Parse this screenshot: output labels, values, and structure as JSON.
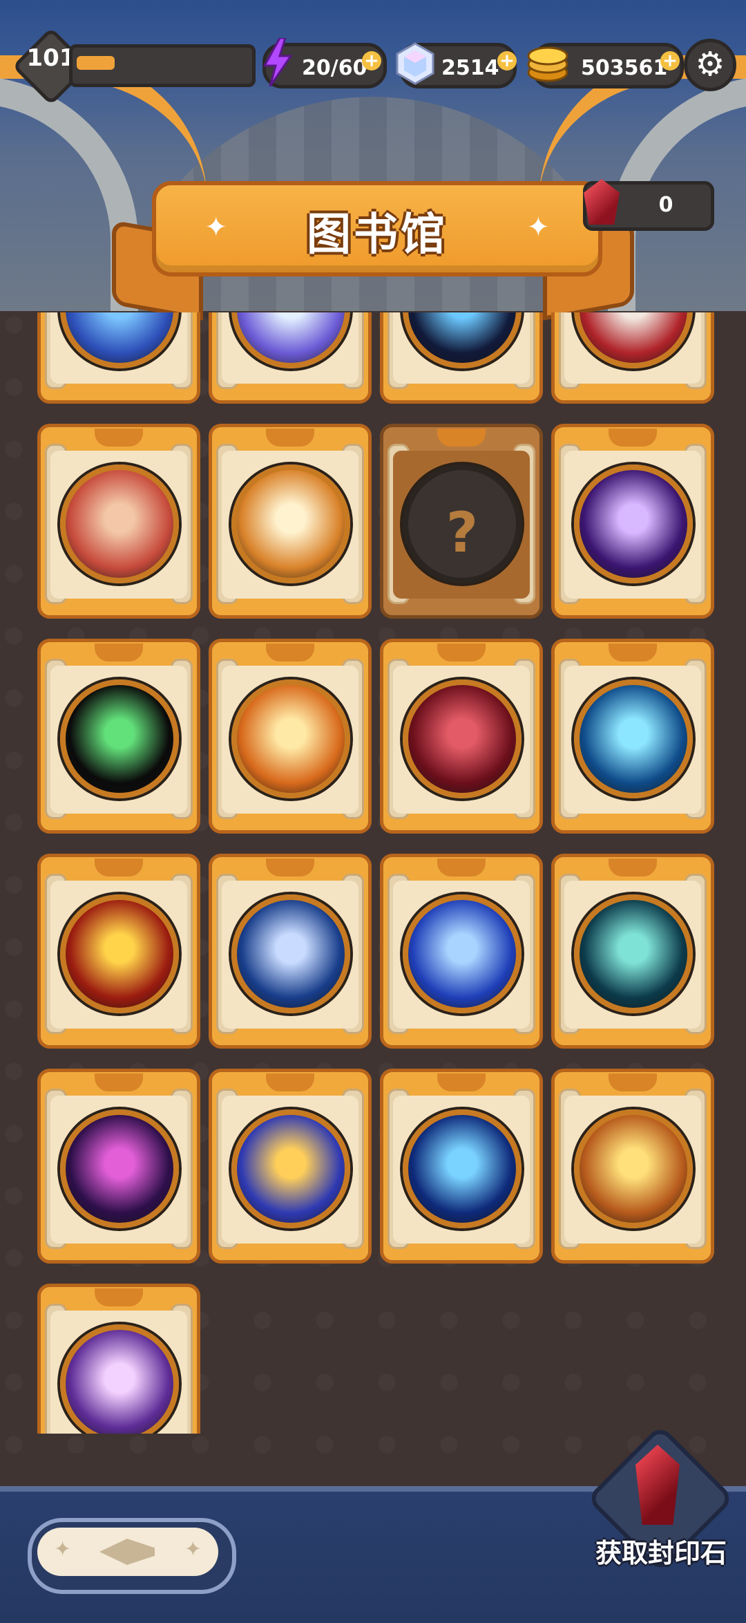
{
  "hud": {
    "level": "101",
    "xp_progress": 0.22,
    "energy": "20/60",
    "gems": "2514",
    "gold": "503561",
    "icons": {
      "energy": "lightning-icon",
      "gems": "diamond-icon",
      "gold": "coin-stack-icon",
      "settings": "gear-icon"
    }
  },
  "title": {
    "text": "图书馆"
  },
  "seal_counter": {
    "value": "0"
  },
  "cards": [
    {
      "id": "skill-1",
      "locked": false,
      "colors": [
        "#2d4fb8",
        "#7cc6ff"
      ]
    },
    {
      "id": "skill-2",
      "locked": false,
      "colors": [
        "#6c5bd6",
        "#e3f1ff"
      ]
    },
    {
      "id": "skill-3",
      "locked": false,
      "colors": [
        "#111a3a",
        "#6cc9ff"
      ]
    },
    {
      "id": "skill-4",
      "locked": false,
      "colors": [
        "#b0242a",
        "#f2e8e0"
      ]
    },
    {
      "id": "skill-5",
      "locked": false,
      "colors": [
        "#c74b3c",
        "#f3c7a8"
      ]
    },
    {
      "id": "skill-6",
      "locked": false,
      "colors": [
        "#d9822a",
        "#fff2cf"
      ]
    },
    {
      "id": "skill-7",
      "locked": true,
      "colors": [
        "#3a3330",
        "#3a3330"
      ]
    },
    {
      "id": "skill-8",
      "locked": false,
      "colors": [
        "#3b1570",
        "#d8b8ff"
      ]
    },
    {
      "id": "skill-9",
      "locked": false,
      "colors": [
        "#0b0b0b",
        "#62e07a"
      ]
    },
    {
      "id": "skill-10",
      "locked": false,
      "colors": [
        "#d86a1c",
        "#ffe9a6"
      ]
    },
    {
      "id": "skill-11",
      "locked": false,
      "colors": [
        "#6b0f1b",
        "#e35b66"
      ]
    },
    {
      "id": "skill-12",
      "locked": false,
      "colors": [
        "#0f4c8a",
        "#8de6ff"
      ]
    },
    {
      "id": "skill-13",
      "locked": false,
      "colors": [
        "#9b1c10",
        "#ffd34a"
      ]
    },
    {
      "id": "skill-14",
      "locked": false,
      "colors": [
        "#183d8a",
        "#c9dcff"
      ]
    },
    {
      "id": "skill-15",
      "locked": false,
      "colors": [
        "#1f3fb8",
        "#a8d4ff"
      ]
    },
    {
      "id": "skill-16",
      "locked": false,
      "colors": [
        "#0c3a4a",
        "#7fe2d7"
      ]
    },
    {
      "id": "skill-17",
      "locked": false,
      "colors": [
        "#2d0f4a",
        "#e35fd8"
      ]
    },
    {
      "id": "skill-18",
      "locked": false,
      "colors": [
        "#2f3ab3",
        "#ffcf5a"
      ]
    },
    {
      "id": "skill-19",
      "locked": false,
      "colors": [
        "#0e2a7a",
        "#7ad3ff"
      ]
    },
    {
      "id": "skill-20",
      "locked": false,
      "colors": [
        "#b65a1c",
        "#ffe07a"
      ]
    },
    {
      "id": "skill-21",
      "locked": false,
      "colors": [
        "#5d2c96",
        "#f4d2ff"
      ]
    }
  ],
  "bottom": {
    "get_seal_label": "获取封印石"
  },
  "colors": {
    "accent": "#f0a23a",
    "panel": "#3d3a39",
    "floor": "#3f3432",
    "nav": "#2a3f6e"
  }
}
